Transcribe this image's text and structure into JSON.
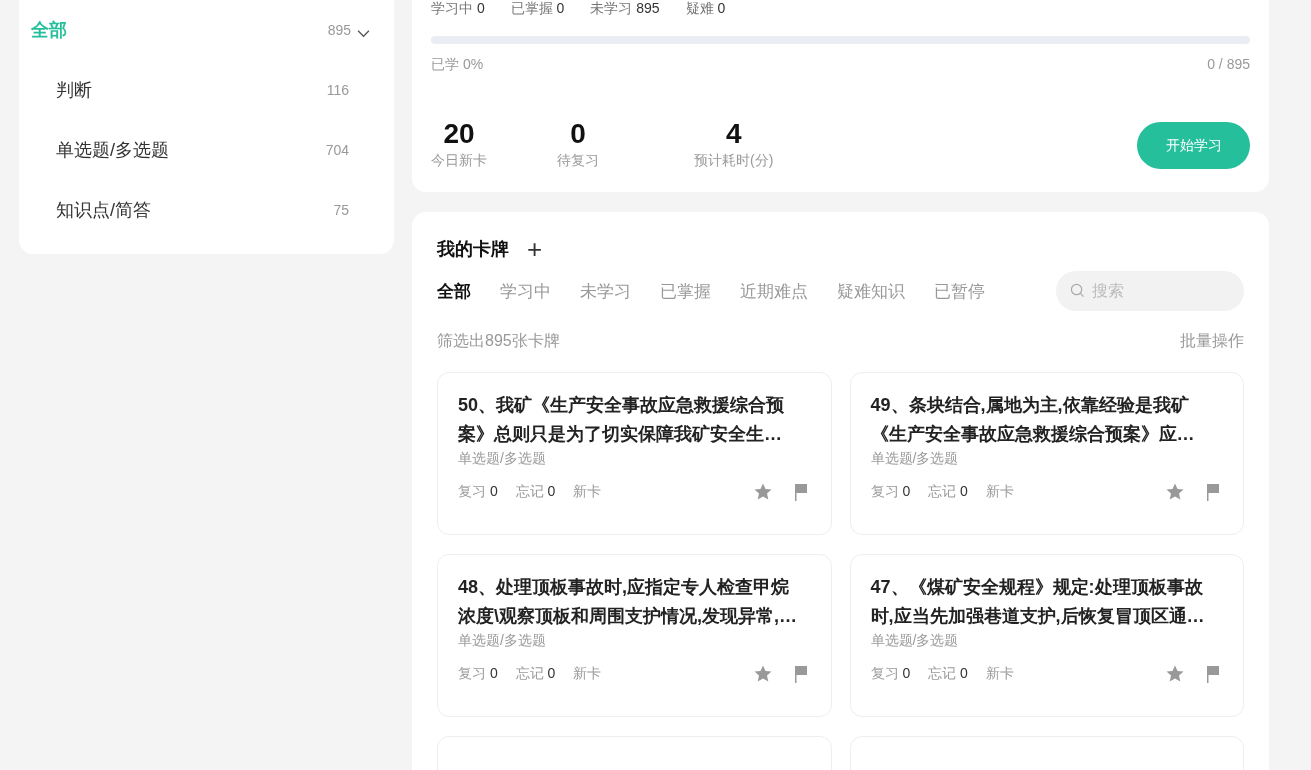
{
  "sidebar": {
    "items": [
      {
        "label": "全部",
        "count": "895",
        "selected": true,
        "expanded": true
      },
      {
        "label": "判断",
        "count": "116",
        "selected": false
      },
      {
        "label": "单选题/多选题",
        "count": "704",
        "selected": false
      },
      {
        "label": "知识点/简答",
        "count": "75",
        "selected": false
      }
    ]
  },
  "overview": {
    "stats": [
      {
        "label": "学习中",
        "value": "0"
      },
      {
        "label": "已掌握",
        "value": "0"
      },
      {
        "label": "未学习",
        "value": "895"
      },
      {
        "label": "疑难",
        "value": "0"
      }
    ],
    "progress": {
      "level": 0,
      "label": "已学 0%",
      "reading": "0 / 895"
    },
    "figures": [
      {
        "value": "20",
        "label": "今日新卡"
      },
      {
        "value": "0",
        "label": "待复习"
      },
      {
        "value": "4",
        "label": "预计耗时(分)"
      }
    ],
    "start_button": "开始学习"
  },
  "cards_panel": {
    "title": "我的卡牌",
    "add_icon": "+",
    "tabs": [
      {
        "label": "全部",
        "selected": true
      },
      {
        "label": "学习中",
        "selected": false
      },
      {
        "label": "未学习",
        "selected": false
      },
      {
        "label": "已掌握",
        "selected": false
      },
      {
        "label": "近期难点",
        "selected": false
      },
      {
        "label": "疑难知识",
        "selected": false
      },
      {
        "label": "已暂停",
        "selected": false
      }
    ],
    "search": {
      "placeholder": "搜索"
    },
    "filter_summary": "筛选出895张卡牌",
    "batch_action": "批量操作",
    "cards": [
      {
        "title_lines": [
          "50、我矿《生产安全事故应急救援综合预",
          "案》总则只是为了切实保障我矿安全生…"
        ],
        "type": "单选题/多选题",
        "review": "复习",
        "review_count": "0",
        "forget": "忘记",
        "forget_count": "0",
        "status": "新卡"
      },
      {
        "title_lines": [
          "49、条块结合,属地为主,依靠经验是我矿",
          "《生产安全事故应急救援综合预案》应…"
        ],
        "type": "单选题/多选题",
        "review": "复习",
        "review_count": "0",
        "forget": "忘记",
        "forget_count": "0",
        "status": "新卡"
      },
      {
        "title_lines": [
          "48、处理顶板事故时,应指定专人检查甲烷",
          "浓度\\观察顶板和周围支护情况,发现异常,…"
        ],
        "type": "单选题/多选题",
        "review": "复习",
        "review_count": "0",
        "forget": "忘记",
        "forget_count": "0",
        "status": "新卡"
      },
      {
        "title_lines": [
          "47、《煤矿安全规程》规定:处理顶板事故",
          "时,应当先加强巷道支护,后恢复冒顶区通…"
        ],
        "type": "单选题/多选题",
        "review": "复习",
        "review_count": "0",
        "forget": "忘记",
        "forget_count": "0",
        "status": "新卡"
      }
    ]
  }
}
